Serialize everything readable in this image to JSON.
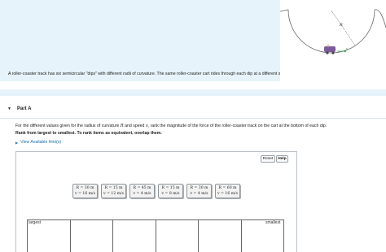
{
  "intro": {
    "text": "A roller-coaster track has six semicircular \"dips\" with different radii of curvature. The same roller-coaster cart rides through each dip at a different speed.",
    "figure_label": "R",
    "figure_speed_label": "v"
  },
  "part": {
    "caret": "▼",
    "title": "Part A"
  },
  "question": {
    "text_1": "For the different values given for the radius of curvature ",
    "var_R": "R",
    "text_2": " and speed ",
    "var_v": "v",
    "text_3": ", rank the magnitude of the force of the roller-coaster track on the cart at the bottom of each dip.",
    "instruction": "Rank from largest to smallest. To rank items as equivalent, overlap them.",
    "hint_caret": "▶",
    "hint_label": "View Available Hint(s)"
  },
  "toolbar": {
    "reset_label": "Reset",
    "help_label": "Help"
  },
  "cards": [
    {
      "r_line": "R = 30 m",
      "v_line": "v = 16 m/s"
    },
    {
      "r_line": "R = 15 m",
      "v_line": "v = 12 m/s"
    },
    {
      "r_line": "R = 45 m",
      "v_line": "v = 4 m/s"
    },
    {
      "r_line": "R = 15 m",
      "v_line": "v = 8 m/s"
    },
    {
      "r_line": "R = 30 m",
      "v_line": "v = 4 m/s"
    },
    {
      "r_line": "R = 60 m",
      "v_line": "v = 16 m/s"
    }
  ],
  "ranking": {
    "largest_label": "largest",
    "smallest_label": "smallest"
  },
  "colors": {
    "intro_background": "#e6f3fa",
    "hint_link": "#1a6ea8",
    "cart": "#7d5a9c"
  }
}
